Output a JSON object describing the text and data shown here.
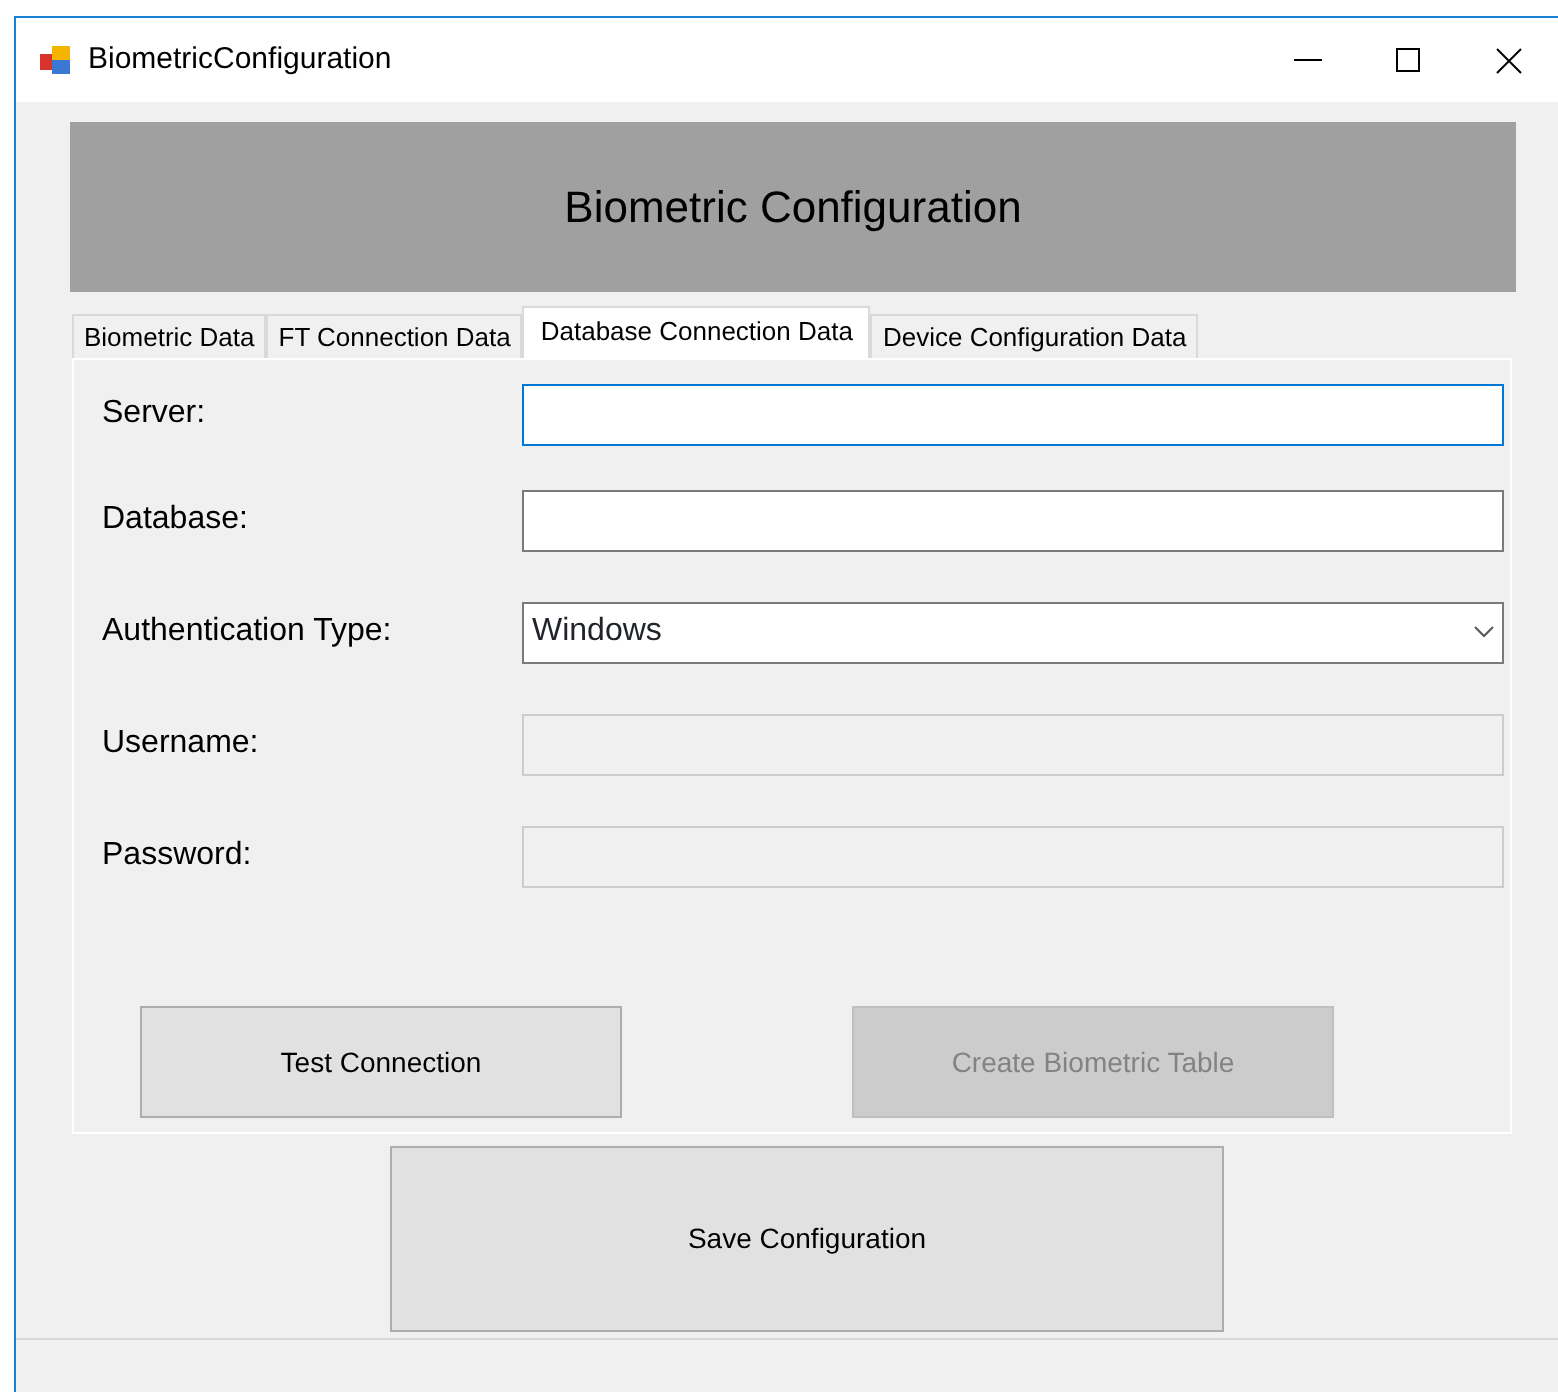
{
  "window": {
    "title": "BiometricConfiguration"
  },
  "header": {
    "title": "Biometric Configuration"
  },
  "tabs": [
    {
      "label": "Biometric Data",
      "selected": false
    },
    {
      "label": "FT Connection Data",
      "selected": false
    },
    {
      "label": "Database Connection Data",
      "selected": true
    },
    {
      "label": "Device Configuration Data",
      "selected": false
    }
  ],
  "fields": [
    {
      "label": "Server:",
      "kind": "text",
      "disabled": false,
      "focused": true
    },
    {
      "label": "Database:",
      "kind": "text",
      "disabled": false,
      "focused": false
    },
    {
      "label": "Authentication Type:",
      "kind": "select",
      "value": "Windows",
      "disabled": false,
      "focused": false
    },
    {
      "label": "Username:",
      "kind": "text",
      "disabled": true,
      "focused": false
    },
    {
      "label": "Password:",
      "kind": "text",
      "disabled": true,
      "focused": false
    }
  ],
  "panel_buttons": [
    {
      "label": "Test Connection",
      "disabled": false
    },
    {
      "label": "Create Biometric Table",
      "disabled": true
    }
  ],
  "save_button": {
    "label": "Save Configuration"
  }
}
